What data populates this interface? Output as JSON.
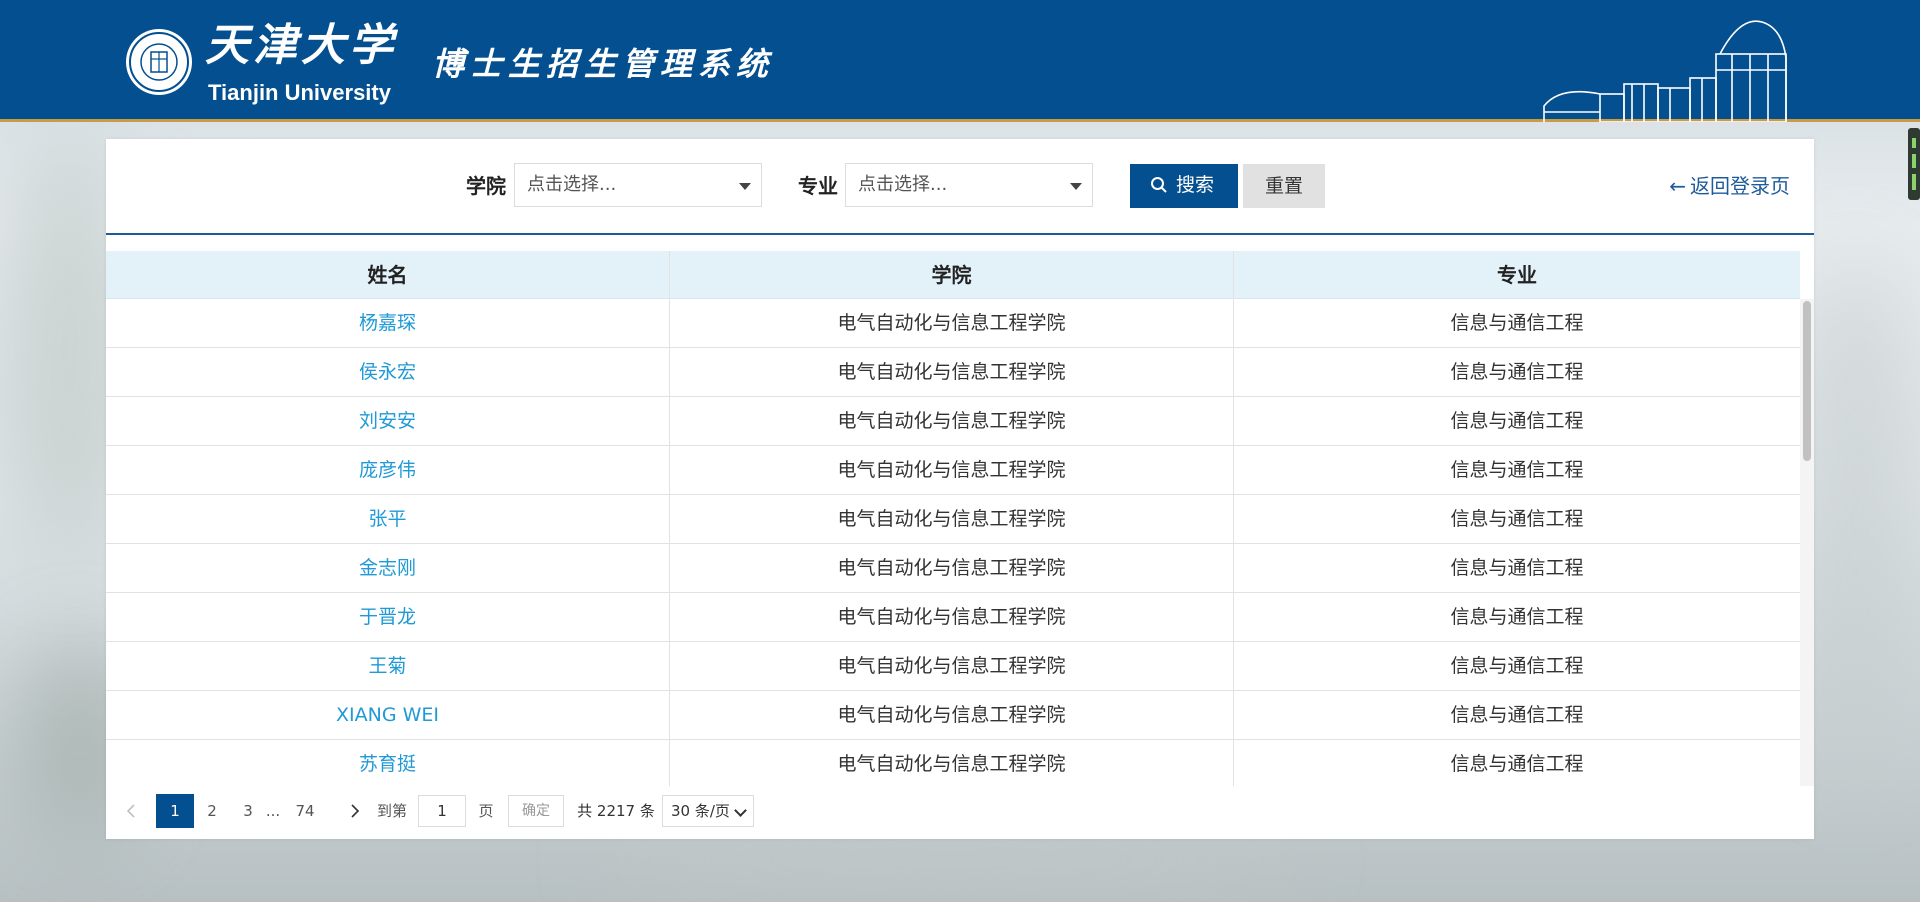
{
  "header": {
    "university_cn": "天津大学",
    "university_en": "Tianjin University",
    "system_title": "博士生招生管理系统"
  },
  "filters": {
    "college_label": "学院",
    "college_value": "点击选择...",
    "major_label": "专业",
    "major_value": "点击选择...",
    "search_label": "搜索",
    "reset_label": "重置",
    "back_label": "返回登录页"
  },
  "table": {
    "headers": [
      "姓名",
      "学院",
      "专业"
    ],
    "rows": [
      {
        "name": "杨嘉琛",
        "college": "电气自动化与信息工程学院",
        "major": "信息与通信工程"
      },
      {
        "name": "侯永宏",
        "college": "电气自动化与信息工程学院",
        "major": "信息与通信工程"
      },
      {
        "name": "刘安安",
        "college": "电气自动化与信息工程学院",
        "major": "信息与通信工程"
      },
      {
        "name": "庞彦伟",
        "college": "电气自动化与信息工程学院",
        "major": "信息与通信工程"
      },
      {
        "name": "张平",
        "college": "电气自动化与信息工程学院",
        "major": "信息与通信工程"
      },
      {
        "name": "金志刚",
        "college": "电气自动化与信息工程学院",
        "major": "信息与通信工程"
      },
      {
        "name": "于晋龙",
        "college": "电气自动化与信息工程学院",
        "major": "信息与通信工程"
      },
      {
        "name": "王菊",
        "college": "电气自动化与信息工程学院",
        "major": "信息与通信工程"
      },
      {
        "name": "XIANG WEI",
        "college": "电气自动化与信息工程学院",
        "major": "信息与通信工程"
      },
      {
        "name": "苏育挺",
        "college": "电气自动化与信息工程学院",
        "major": "信息与通信工程"
      }
    ]
  },
  "pagination": {
    "pages": [
      "1",
      "2",
      "3"
    ],
    "ellipsis": "...",
    "last_page": "74",
    "goto_label": "到第",
    "goto_value": "1",
    "page_unit": "页",
    "confirm_label": "确定",
    "total_label": "共 2217 条",
    "page_size": "30 条/页"
  },
  "colors": {
    "header_bg": "#044f8f",
    "header_border": "#c99c41",
    "link": "#1f9ad6",
    "table_header_bg": "#e3f1f9"
  }
}
